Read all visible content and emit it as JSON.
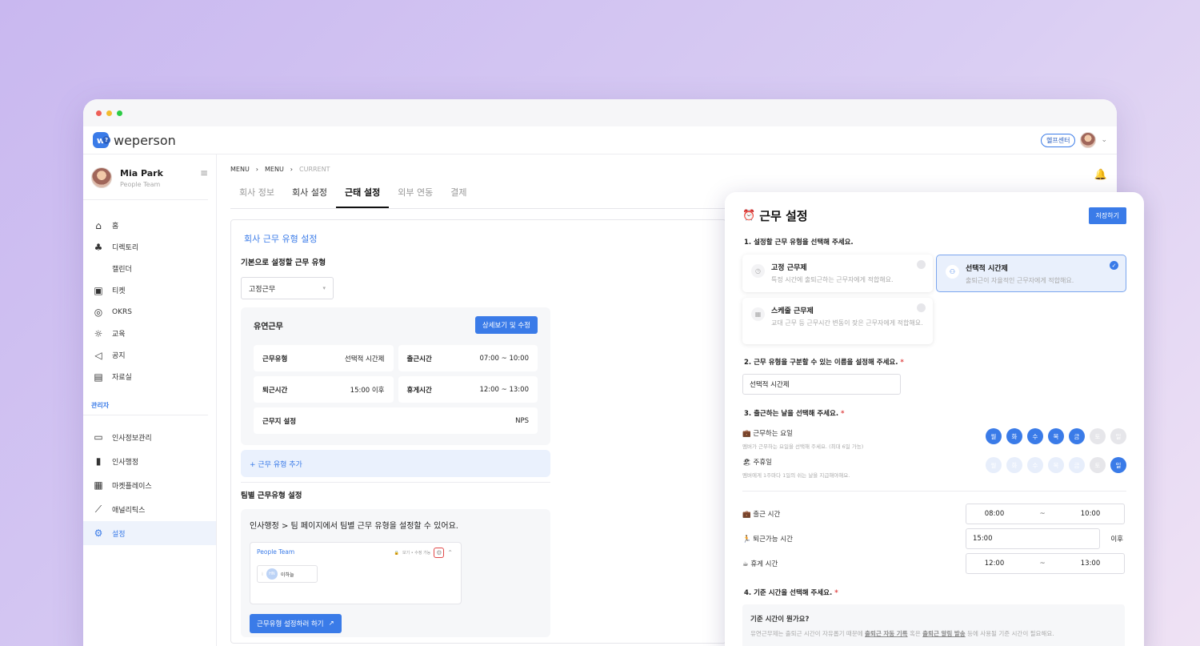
{
  "window": {
    "dots": [
      "#ee5f57",
      "#f2bc2f",
      "#2ccb45"
    ]
  },
  "topbar": {
    "logo_text": "weperson",
    "logo_mark": "w",
    "help_label": "헬프센터",
    "help_icon": "?"
  },
  "profile": {
    "name": "Mia Park",
    "team": "People Team"
  },
  "sidebar": {
    "items": [
      {
        "label": "홈",
        "icon": "home-icon"
      },
      {
        "label": "디렉토리",
        "icon": "org-chart-icon"
      },
      {
        "label": "캘린더",
        "icon": ""
      },
      {
        "label": "티켓",
        "icon": "ticket-icon"
      },
      {
        "label": "OKRS",
        "icon": "target-icon"
      },
      {
        "label": "교육",
        "icon": "lightbulb-icon"
      },
      {
        "label": "공지",
        "icon": "megaphone-icon"
      },
      {
        "label": "자료실",
        "icon": "archive-icon"
      }
    ],
    "admin_section": "관리자",
    "admin_items": [
      {
        "label": "인사정보관리",
        "icon": "folder-person-icon"
      },
      {
        "label": "인사행정",
        "icon": "file-icon"
      },
      {
        "label": "마켓플레이스",
        "icon": "gift-icon"
      },
      {
        "label": "애널리틱스",
        "icon": "chart-icon"
      },
      {
        "label": "설정",
        "icon": "gear-icon",
        "active": true
      }
    ]
  },
  "breadcrumb": {
    "items": [
      "MENU",
      "MENU",
      "CURRENT"
    ]
  },
  "tabs": [
    "회사 정보",
    "회사 설정",
    "근태 설정",
    "외부 연동",
    "결제"
  ],
  "panel": {
    "heading": "회사 근무 유형 설정",
    "default_label": "기본으로 설정할 근무 유형",
    "default_select": "고정근무",
    "card": {
      "title": "유연근무",
      "detail_button": "상세보기 및 수정",
      "rows": [
        {
          "k": "근무유형",
          "v": "선택적 시간제"
        },
        {
          "k": "출근시간",
          "v": "07:00 ~ 10:00"
        },
        {
          "k": "퇴근시간",
          "v": "15:00 이후"
        },
        {
          "k": "휴게시간",
          "v": "12:00 ~ 13:00"
        },
        {
          "k": "근무지 설정",
          "v": "NPS"
        }
      ]
    },
    "add_type": "+ 근무 유형 추가",
    "team_label": "팀별 근무유형 설정",
    "team_text": "인사행정 > 팀 페이지에서 팀별 근무 유형을 설정할 수 있어요.",
    "mini": {
      "title": "People Team",
      "right_text": "보기 • 수정 가능",
      "chip_name": "이하늘",
      "chip_initial": "HN"
    },
    "go_button": "근무유형 설정하러 하기",
    "go_arrow": "↗"
  },
  "modal": {
    "title": "근무 설정",
    "save": "저장하기",
    "q1": "1. 설정할 근무 유형을 선택해 주세요.",
    "options": [
      {
        "title": "고정 근무제",
        "desc": "특정 시간에 출퇴근하는 근무자에게 적합해요."
      },
      {
        "title": "선택적 시간제",
        "desc": "출퇴근이 자율적인 근무자에게 적합해요."
      },
      {
        "title": "스케줄 근무제",
        "desc": "교대 근무 등 근무시간 변동이 잦은 근무자에게 적합해요."
      }
    ],
    "q2": "2. 근무 유형을 구분할 수 있는 이름을 설정해 주세요.",
    "name_value": "선택적 시간제",
    "q3": "3. 출근하는 날을 선택해 주세요.",
    "workdays_label": "💼 근무하는 요일",
    "workdays_desc": "멤버가 근무하는 요일을 선택해 주세요. (최대 6일 가능)",
    "holiday_label": "🏖 주휴일",
    "holiday_desc": "멤버에게 1주마다 1일의 쉬는 날을 지급해야해요.",
    "days": [
      "월",
      "화",
      "수",
      "목",
      "금",
      "토",
      "일"
    ],
    "workdays_selected": [
      true,
      true,
      true,
      true,
      true,
      false,
      false
    ],
    "holiday_selected": [
      false,
      false,
      false,
      false,
      false,
      false,
      true
    ],
    "required_mark": "*",
    "start_label": "💼 출근 시간",
    "start_from": "08:00",
    "tilde": "~",
    "start_to": "10:00",
    "leave_label": "🏃 퇴근가능 시간",
    "leave_value": "15:00",
    "leave_after": "이후",
    "break_label": "☕ 휴게 시간",
    "break_from": "12:00",
    "break_to": "13:00",
    "q4": "4. 기준 시간을 선택해 주세요.",
    "info_title": "기준 시간이 뭔가요?",
    "info_pre": "유연근무제는 출퇴근 시간이 자유롭기 때문에",
    "info_b1": "출퇴근 자동 기록",
    "info_mid": "혹은",
    "info_b2": "출퇴근 알림 발송",
    "info_post": "등에 사용될 기준 시간이 필요해요."
  }
}
